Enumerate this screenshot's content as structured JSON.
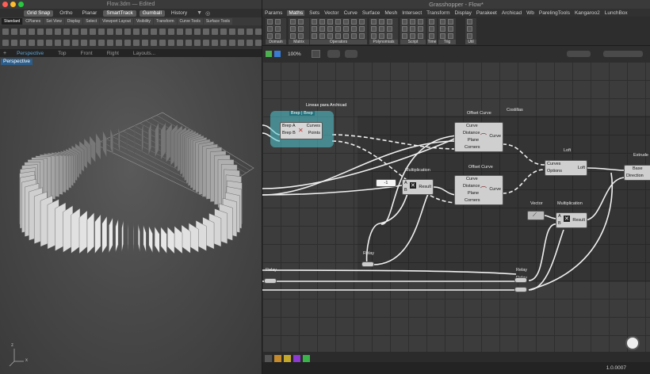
{
  "rhino": {
    "title": "Flow.3dm — Edited",
    "status_bar": [
      "Grid Snap",
      "Ortho",
      "Planar",
      "SmartTrack",
      "Gumball",
      "History"
    ],
    "status_on": [
      true,
      false,
      false,
      true,
      true,
      false
    ],
    "toolbar_tabs": [
      "Standard",
      "CPlanes",
      "Set View",
      "Display",
      "Select",
      "Viewport Layout",
      "Visibility",
      "Transform",
      "Curve Tools",
      "Surface Tools"
    ],
    "viewport_tabs": [
      "Perspective",
      "Top",
      "Front",
      "Right",
      "Layouts..."
    ],
    "viewport_label": "Perspective",
    "axis_z": "z",
    "axis_x": "x"
  },
  "gh": {
    "title": "Grasshopper - Flow*",
    "menu": [
      "Params",
      "Maths",
      "Sets",
      "Vector",
      "Curve",
      "Surface",
      "Mesh",
      "Intersect",
      "Transform",
      "Display",
      "Parakeet",
      "Archicad",
      "Wb",
      "ParelingTools",
      "Kangaroo2",
      "LunchBox"
    ],
    "ribbon_groups": [
      "Domain",
      "Matrix",
      "Operators",
      "Polynomials",
      "Script",
      "Time",
      "Trig",
      "Util"
    ],
    "zoom": "100%",
    "version": "1.0.0007",
    "components": {
      "group_label": "Lineas para Archicad",
      "brep_label": "Brep | Brep",
      "brep_in": [
        "Brep A",
        "Brep B"
      ],
      "brep_out": [
        "Curves",
        "Points"
      ],
      "offset1_title": "Offset Curve",
      "offset2_title": "Offset Curve",
      "offset_in": [
        "Curve",
        "Distance",
        "Plane",
        "Corners"
      ],
      "offset_out": "Curve",
      "costillas": "Costillas",
      "loft_title": "Loft",
      "loft_in": [
        "Curves",
        "Options"
      ],
      "loft_out": "Loft",
      "extrude_title": "Extrude",
      "extrude_in": [
        "Base",
        "Direction"
      ],
      "mult1_title": "Multiplication",
      "mult2_title": "Multiplication",
      "mult_in": [
        "A",
        "B"
      ],
      "mult_out": "Result",
      "vector_title": "Vector",
      "relay": "Relay",
      "slider_val": "-1"
    }
  }
}
